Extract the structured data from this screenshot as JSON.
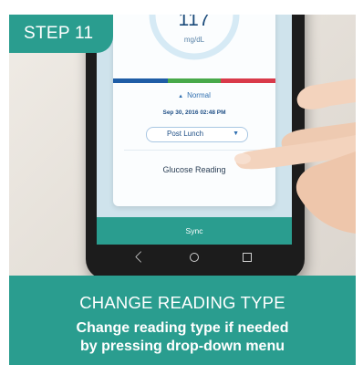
{
  "step": {
    "label": "STEP 11"
  },
  "reading": {
    "value": "117",
    "unit": "mg/dL",
    "status": "Normal",
    "datetime": "Sep 30, 2016 02:48 PM",
    "type_selected": "Post Lunch",
    "title": "Glucose Reading"
  },
  "sync": {
    "label": "Sync"
  },
  "caption": {
    "title": "CHANGE READING TYPE",
    "description_line1": "Change reading type if needed",
    "description_line2": "by pressing drop-down menu"
  },
  "colors": {
    "teal": "#2a9d8f",
    "low": "#1f5da6",
    "normal": "#48a94a",
    "high": "#d93a4a"
  }
}
